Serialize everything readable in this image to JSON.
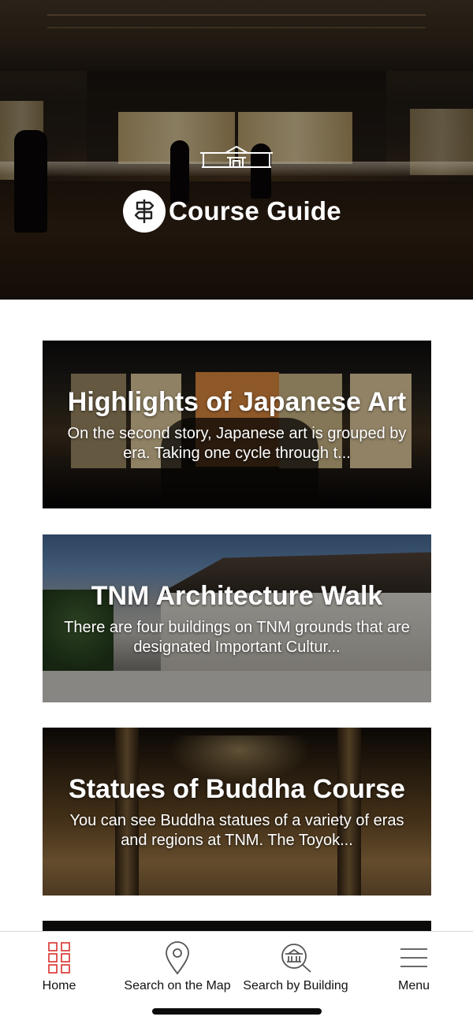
{
  "hero": {
    "title": "Course Guide"
  },
  "courses": [
    {
      "title": "Highlights of Japanese Art",
      "description": "On the second story, Japanese art is grouped by era. Taking one cycle through t..."
    },
    {
      "title": "TNM Architecture Walk",
      "description": "There are four buildings on TNM grounds that are designated Important Cultur..."
    },
    {
      "title": "Statues of Buddha Course",
      "description": "You can see Buddha statues of a variety of eras and regions at TNM. The Toyok..."
    }
  ],
  "bottom_nav": {
    "items": [
      {
        "label": "Home",
        "icon": "grid-icon",
        "active": true
      },
      {
        "label": "Search on the Map",
        "icon": "map-pin-icon",
        "active": false
      },
      {
        "label": "Search by Building",
        "icon": "building-search-icon",
        "active": false
      },
      {
        "label": "Menu",
        "icon": "hamburger-menu-icon",
        "active": false
      }
    ]
  },
  "colors": {
    "accent": "#d9302c",
    "text_dark": "#111111",
    "icon_gray": "#555555"
  }
}
